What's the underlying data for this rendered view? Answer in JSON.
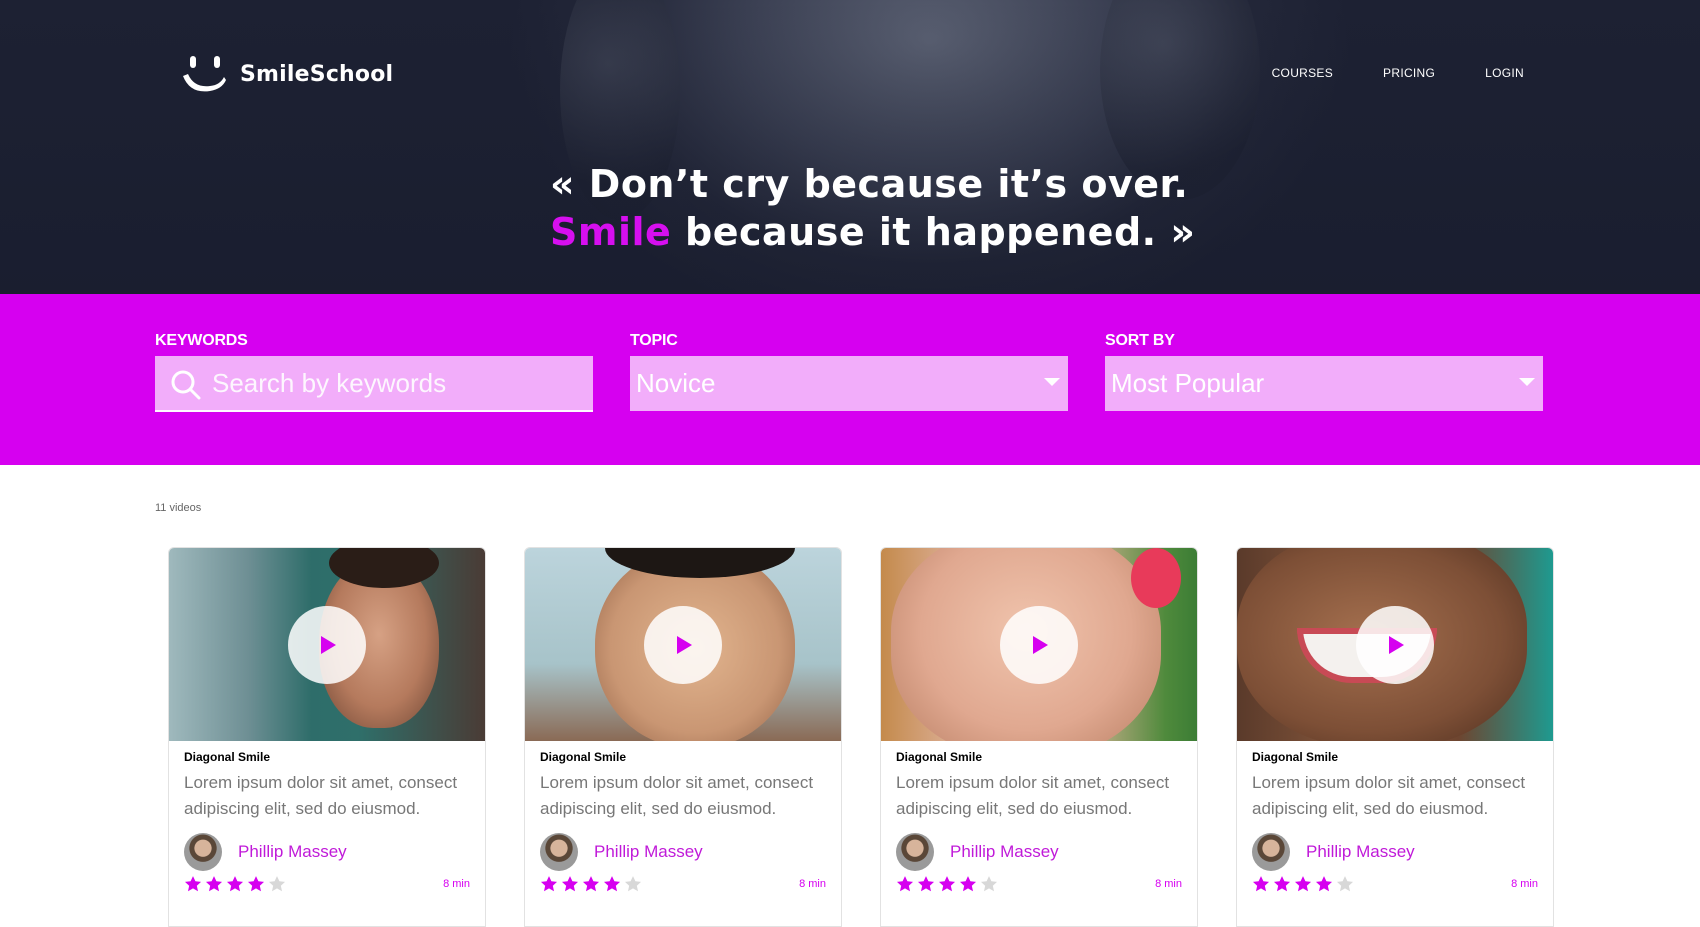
{
  "brand": {
    "name": "SmileSchool",
    "accent": "#d600f0"
  },
  "nav": {
    "items": [
      "COURSES",
      "PRICING",
      "LOGIN"
    ]
  },
  "hero": {
    "quote_line1": "« Don’t cry because it’s over.",
    "quote_accent": "Smile",
    "quote_line2_rest": " because it happened. »"
  },
  "filters": {
    "keywords": {
      "label": "KEYWORDS",
      "placeholder": "Search by keywords",
      "icon": "search-icon"
    },
    "topic": {
      "label": "TOPIC",
      "value": "Novice"
    },
    "sort": {
      "label": "SORT BY",
      "value": "Most Popular"
    }
  },
  "results": {
    "count": "11 videos"
  },
  "cards": [
    {
      "title": "Diagonal Smile",
      "description": "Lorem ipsum dolor sit amet, consect adipiscing elit, sed do eiusmod.",
      "author": "Phillip Massey",
      "rating": 4,
      "max_rating": 5,
      "duration": "8 min"
    },
    {
      "title": "Diagonal Smile",
      "description": "Lorem ipsum dolor sit amet, consect adipiscing elit, sed do eiusmod.",
      "author": "Phillip Massey",
      "rating": 4,
      "max_rating": 5,
      "duration": "8 min"
    },
    {
      "title": "Diagonal Smile",
      "description": "Lorem ipsum dolor sit amet, consect adipiscing elit, sed do eiusmod.",
      "author": "Phillip Massey",
      "rating": 4,
      "max_rating": 5,
      "duration": "8 min"
    },
    {
      "title": "Diagonal Smile",
      "description": "Lorem ipsum dolor sit amet, consect adipiscing elit, sed do eiusmod.",
      "author": "Phillip Massey",
      "rating": 4,
      "max_rating": 5,
      "duration": "8 min"
    }
  ]
}
